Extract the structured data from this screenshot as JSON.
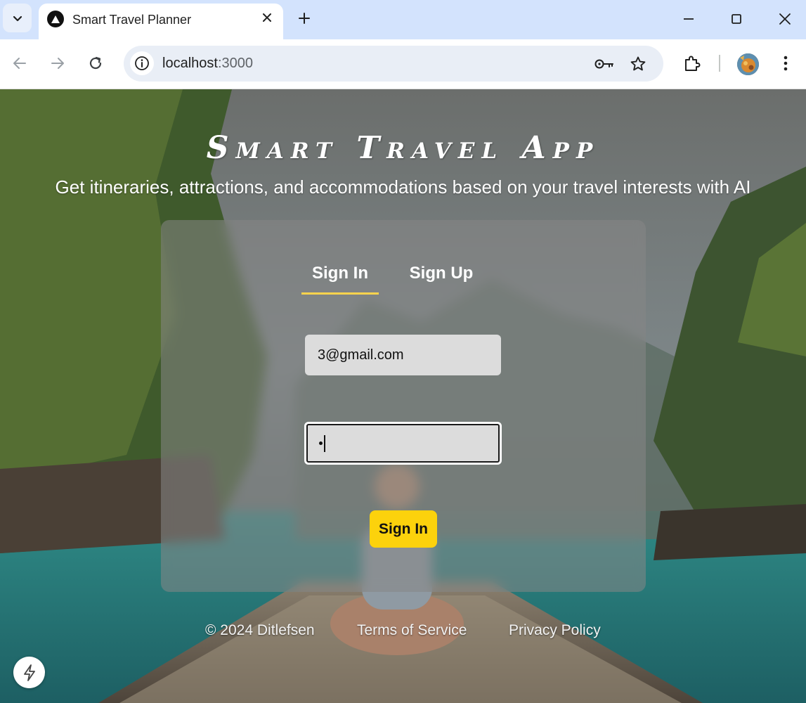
{
  "browser": {
    "tab_title": "Smart Travel Planner",
    "url_host": "localhost",
    "url_port": ":3000"
  },
  "page": {
    "app_title": "Smart Travel App",
    "subtitle": "Get itineraries, attractions, and accommodations based on your travel interests with AI",
    "tabs": [
      {
        "label": "Sign In",
        "active": true
      },
      {
        "label": "Sign Up",
        "active": false
      }
    ],
    "email_value": "3@gmail.com",
    "password_value": "•",
    "submit_label": "Sign In",
    "footer": {
      "copyright": "© 2024 Ditlefsen",
      "terms": "Terms of Service",
      "privacy": "Privacy Policy"
    }
  },
  "colors": {
    "accent": "#fcd20c",
    "tab_underline": "#fcd34d",
    "chrome_tabbar": "#d3e3fd"
  },
  "icons": {
    "favicon": "triangle-logo-icon",
    "dev_badge": "lightning-bolt-icon"
  }
}
